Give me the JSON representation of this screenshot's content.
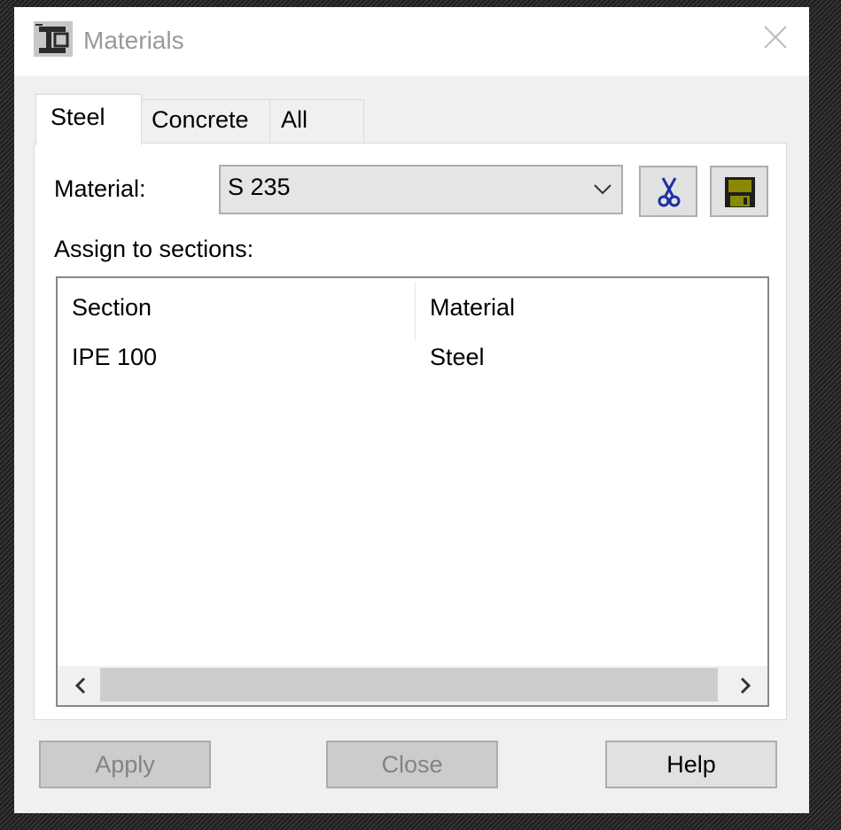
{
  "window": {
    "title": "Materials",
    "app_icon": "beam-section-icon",
    "close_icon": "close-icon"
  },
  "tabs": [
    {
      "label": "Steel",
      "selected": true
    },
    {
      "label": "Concrete",
      "selected": false
    },
    {
      "label": "All",
      "selected": false
    }
  ],
  "material_row": {
    "label": "Material:",
    "selected_value": "S 235",
    "dropdown_icon": "chevron-down-icon",
    "cut_icon": "scissors-icon",
    "save_icon": "floppy-disk-icon"
  },
  "assign_label": "Assign to sections:",
  "table": {
    "columns": [
      "Section",
      "Material"
    ],
    "rows": [
      [
        "IPE 100",
        "Steel"
      ]
    ]
  },
  "buttons": {
    "apply": "Apply",
    "close": "Close",
    "help": "Help"
  },
  "colors": {
    "scissors": "#1c2ea8",
    "floppy": "#6b6b00"
  }
}
